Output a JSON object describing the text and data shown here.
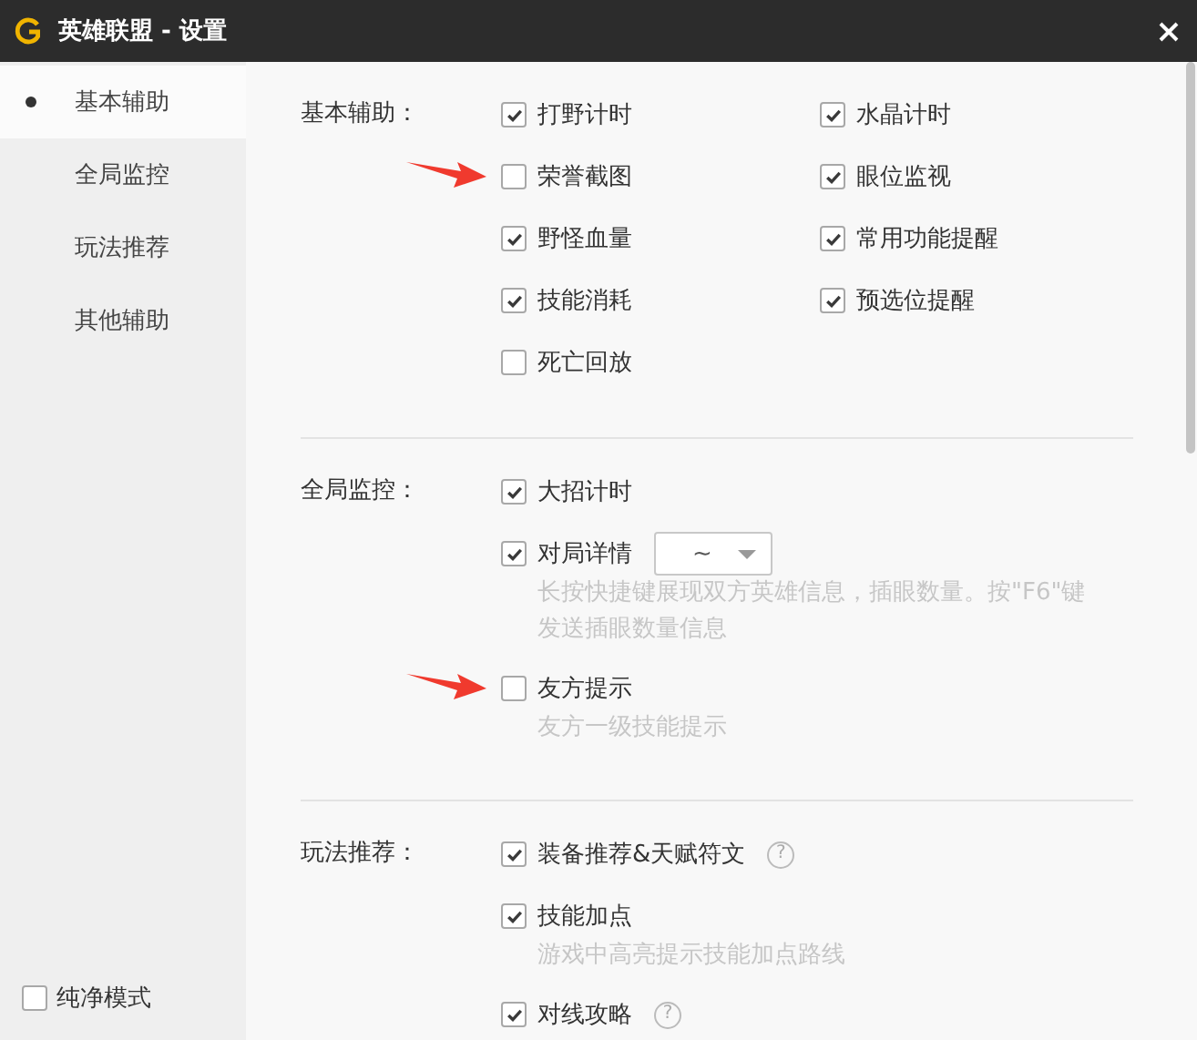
{
  "window": {
    "title": "英雄联盟 - 设置"
  },
  "sidebar": {
    "items": [
      {
        "label": "基本辅助",
        "selected": true
      },
      {
        "label": "全局监控",
        "selected": false
      },
      {
        "label": "玩法推荐",
        "selected": false
      },
      {
        "label": "其他辅助",
        "selected": false
      }
    ],
    "pure_mode": {
      "label": "纯净模式",
      "checked": false
    }
  },
  "sections": [
    {
      "label": "基本辅助：",
      "rows": [
        [
          {
            "label": "打野计时",
            "checked": true,
            "marked": false
          },
          {
            "label": "水晶计时",
            "checked": true,
            "marked": false
          }
        ],
        [
          {
            "label": "荣誉截图",
            "checked": false,
            "marked": true
          },
          {
            "label": "眼位监视",
            "checked": true,
            "marked": false
          }
        ],
        [
          {
            "label": "野怪血量",
            "checked": true,
            "marked": false
          },
          {
            "label": "常用功能提醒",
            "checked": true,
            "marked": false
          }
        ],
        [
          {
            "label": "技能消耗",
            "checked": true,
            "marked": false
          },
          {
            "label": "预选位提醒",
            "checked": true,
            "marked": false
          }
        ],
        [
          {
            "label": "死亡回放",
            "checked": false,
            "marked": false
          }
        ]
      ]
    },
    {
      "label": "全局监控：",
      "rows": [
        [
          {
            "label": "大招计时",
            "checked": true,
            "marked": false
          }
        ],
        [
          {
            "label": "对局详情",
            "checked": true,
            "marked": false,
            "dropdown": {
              "value": "~"
            },
            "description": "长按快捷键展现双方英雄信息，插眼数量。按\"F6\"键发送插眼数量信息"
          }
        ],
        [
          {
            "label": "友方提示",
            "checked": false,
            "marked": true,
            "description": "友方一级技能提示"
          }
        ]
      ]
    },
    {
      "label": "玩法推荐：",
      "rows": [
        [
          {
            "label": "装备推荐&天赋符文",
            "checked": true,
            "marked": false,
            "help": "?"
          }
        ],
        [
          {
            "label": "技能加点",
            "checked": true,
            "marked": false,
            "description": "游戏中高亮提示技能加点路线"
          }
        ],
        [
          {
            "label": "对线攻略",
            "checked": true,
            "marked": false,
            "help": "?"
          }
        ]
      ]
    }
  ]
}
